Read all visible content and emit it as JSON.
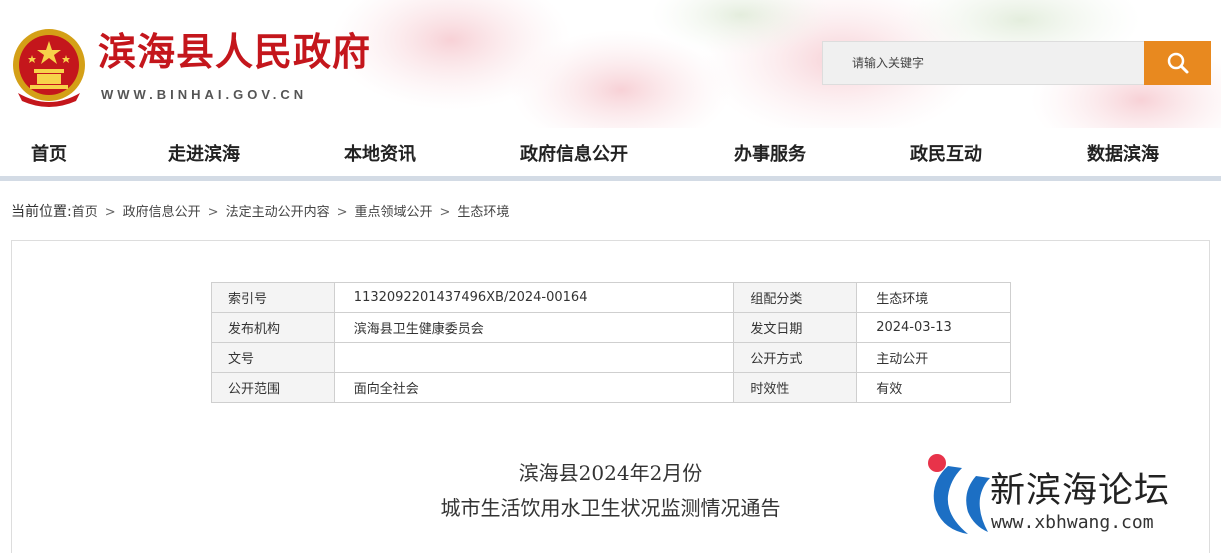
{
  "site": {
    "title": "滨海县人民政府",
    "url": "WWW.BINHAI.GOV.CN"
  },
  "search": {
    "placeholder": "请输入关键字"
  },
  "nav": [
    "首页",
    "走进滨海",
    "本地资讯",
    "政府信息公开",
    "办事服务",
    "政民互动",
    "数据滨海"
  ],
  "breadcrumb": {
    "label": "当前位置:",
    "items": [
      "首页",
      "政府信息公开",
      "法定主动公开内容",
      "重点领域公开",
      "生态环境"
    ],
    "separator": ">"
  },
  "meta": {
    "rows": [
      {
        "k1": "索引号",
        "v1": "1132092201437496XB/2024-00164",
        "k2": "组配分类",
        "v2": "生态环境"
      },
      {
        "k1": "发布机构",
        "v1": "滨海县卫生健康委员会",
        "k2": "发文日期",
        "v2": "2024-03-13"
      },
      {
        "k1": "文号",
        "v1": "",
        "k2": "公开方式",
        "v2": "主动公开"
      },
      {
        "k1": "公开范围",
        "v1": "面向全社会",
        "k2": "时效性",
        "v2": "有效"
      }
    ]
  },
  "article": {
    "title_line1": "滨海县2024年2月份",
    "title_line2": "城市生活饮用水卫生状况监测情况通告"
  },
  "watermark": {
    "name": "新滨海论坛",
    "url": "www.xbhwang.com"
  },
  "colors": {
    "brand_red": "#c4161c",
    "search_orange": "#e8891f"
  }
}
